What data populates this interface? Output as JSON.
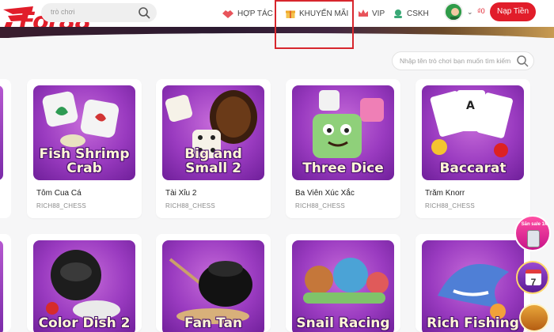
{
  "header": {
    "logo_text": "For88",
    "search_placeholder": "trò chơi",
    "nav": [
      {
        "label": "HỢP TÁC",
        "icon": "handshake-icon"
      },
      {
        "label": "KHUYẾN MÃI",
        "icon": "gift-icon"
      },
      {
        "label": "VIP",
        "icon": "crown-icon"
      },
      {
        "label": "CSKH",
        "icon": "headset-icon"
      }
    ],
    "balance": "₫0",
    "deposit_label": "Nạp Tiền"
  },
  "game_search": {
    "placeholder": "Nhập tên trò chơi bạn muốn tìm kiếm"
  },
  "games": [
    {
      "art_title": "Fish Shrimp Crab",
      "name": "Tôm Cua Cá",
      "provider": "RICH88_CHESS"
    },
    {
      "art_title": "Big and Small 2",
      "name": "Tài Xỉu 2",
      "provider": "RICH88_CHESS"
    },
    {
      "art_title": "Three Dice",
      "name": "Ba Viên Xúc Xắc",
      "provider": "RICH88_CHESS"
    },
    {
      "art_title": "Baccarat",
      "name": "Trăm Knorr",
      "provider": "RICH88_CHESS"
    },
    {
      "art_title": "Color Dish 2",
      "name": "",
      "provider": ""
    },
    {
      "art_title": "Fan Tan",
      "name": "",
      "provider": ""
    },
    {
      "art_title": "Snail Racing",
      "name": "",
      "provider": ""
    },
    {
      "art_title": "Rich Fishing",
      "name": "",
      "provider": ""
    }
  ],
  "floating": {
    "promo_label": "Săn sale 1k",
    "calendar_day": "7"
  },
  "colors": {
    "brand_red": "#e11d2a",
    "card_purple": "#9a3bc0",
    "highlight": "#d7262d"
  }
}
